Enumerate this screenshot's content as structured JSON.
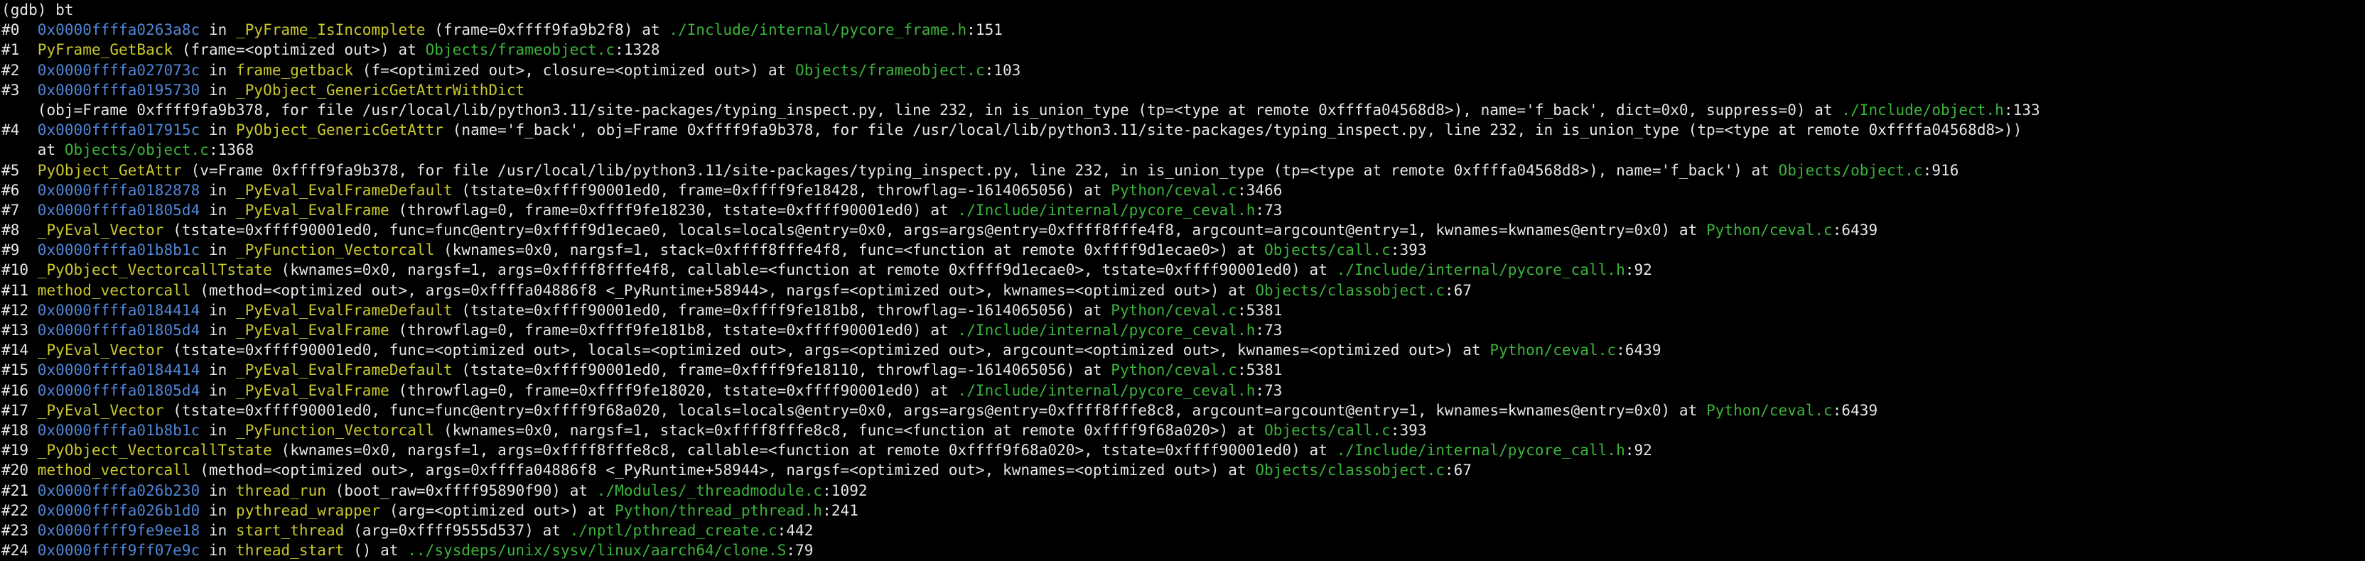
{
  "colors": {
    "background": "#000000",
    "text": "#e6e6e6",
    "address": "#4f86d8",
    "function": "#c9c92b",
    "file": "#3ab53a"
  },
  "lines": [
    [
      [
        "p",
        "(gdb) bt"
      ]
    ],
    [
      [
        "p",
        "#0  "
      ],
      [
        "a",
        "0x0000ffffa0263a8c"
      ],
      [
        "p",
        " in "
      ],
      [
        "f",
        "_PyFrame_IsIncomplete"
      ],
      [
        "p",
        " (frame=0xffff9fa9b2f8) at "
      ],
      [
        "s",
        "./Include/internal/pycore_frame.h"
      ],
      [
        "p",
        ":151"
      ]
    ],
    [
      [
        "p",
        "#1  "
      ],
      [
        "f",
        "PyFrame_GetBack"
      ],
      [
        "p",
        " (frame=<optimized out>) at "
      ],
      [
        "s",
        "Objects/frameobject.c"
      ],
      [
        "p",
        ":1328"
      ]
    ],
    [
      [
        "p",
        "#2  "
      ],
      [
        "a",
        "0x0000ffffa027073c"
      ],
      [
        "p",
        " in "
      ],
      [
        "f",
        "frame_getback"
      ],
      [
        "p",
        " (f=<optimized out>, closure=<optimized out>) at "
      ],
      [
        "s",
        "Objects/frameobject.c"
      ],
      [
        "p",
        ":103"
      ]
    ],
    [
      [
        "p",
        "#3  "
      ],
      [
        "a",
        "0x0000ffffa0195730"
      ],
      [
        "p",
        " in "
      ],
      [
        "f",
        "_PyObject_GenericGetAttrWithDict"
      ]
    ],
    [
      [
        "p",
        "    (obj=Frame 0xffff9fa9b378, for file /usr/local/lib/python3.11/site-packages/typing_inspect.py, line 232, in is_union_type (tp=<type at remote 0xffffa04568d8>), name='f_back', dict=0x0, suppress=0) at "
      ],
      [
        "s",
        "./Include/object.h"
      ],
      [
        "p",
        ":133"
      ]
    ],
    [
      [
        "p",
        "#4  "
      ],
      [
        "a",
        "0x0000ffffa017915c"
      ],
      [
        "p",
        " in "
      ],
      [
        "f",
        "PyObject_GenericGetAttr"
      ],
      [
        "p",
        " (name='f_back', obj=Frame 0xffff9fa9b378, for file /usr/local/lib/python3.11/site-packages/typing_inspect.py, line 232, in is_union_type (tp=<type at remote 0xffffa04568d8>))"
      ]
    ],
    [
      [
        "p",
        "    at "
      ],
      [
        "s",
        "Objects/object.c"
      ],
      [
        "p",
        ":1368"
      ]
    ],
    [
      [
        "p",
        "#5  "
      ],
      [
        "f",
        "PyObject_GetAttr"
      ],
      [
        "p",
        " (v=Frame 0xffff9fa9b378, for file /usr/local/lib/python3.11/site-packages/typing_inspect.py, line 232, in is_union_type (tp=<type at remote 0xffffa04568d8>), name='f_back') at "
      ],
      [
        "s",
        "Objects/object.c"
      ],
      [
        "p",
        ":916"
      ]
    ],
    [
      [
        "p",
        "#6  "
      ],
      [
        "a",
        "0x0000ffffa0182878"
      ],
      [
        "p",
        " in "
      ],
      [
        "f",
        "_PyEval_EvalFrameDefault"
      ],
      [
        "p",
        " (tstate=0xffff90001ed0, frame=0xffff9fe18428, throwflag=-1614065056) at "
      ],
      [
        "s",
        "Python/ceval.c"
      ],
      [
        "p",
        ":3466"
      ]
    ],
    [
      [
        "p",
        "#7  "
      ],
      [
        "a",
        "0x0000ffffa01805d4"
      ],
      [
        "p",
        " in "
      ],
      [
        "f",
        "_PyEval_EvalFrame"
      ],
      [
        "p",
        " (throwflag=0, frame=0xffff9fe18230, tstate=0xffff90001ed0) at "
      ],
      [
        "s",
        "./Include/internal/pycore_ceval.h"
      ],
      [
        "p",
        ":73"
      ]
    ],
    [
      [
        "p",
        "#8  "
      ],
      [
        "f",
        "_PyEval_Vector"
      ],
      [
        "p",
        " (tstate=0xffff90001ed0, func=func@entry=0xffff9d1ecae0, locals=locals@entry=0x0, args=args@entry=0xffff8fffe4f8, argcount=argcount@entry=1, kwnames=kwnames@entry=0x0) at "
      ],
      [
        "s",
        "Python/ceval.c"
      ],
      [
        "p",
        ":6439"
      ]
    ],
    [
      [
        "p",
        "#9  "
      ],
      [
        "a",
        "0x0000ffffa01b8b1c"
      ],
      [
        "p",
        " in "
      ],
      [
        "f",
        "_PyFunction_Vectorcall"
      ],
      [
        "p",
        " (kwnames=0x0, nargsf=1, stack=0xffff8fffe4f8, func=<function at remote 0xffff9d1ecae0>) at "
      ],
      [
        "s",
        "Objects/call.c"
      ],
      [
        "p",
        ":393"
      ]
    ],
    [
      [
        "p",
        "#10 "
      ],
      [
        "f",
        "_PyObject_VectorcallTstate"
      ],
      [
        "p",
        " (kwnames=0x0, nargsf=1, args=0xffff8fffe4f8, callable=<function at remote 0xffff9d1ecae0>, tstate=0xffff90001ed0) at "
      ],
      [
        "s",
        "./Include/internal/pycore_call.h"
      ],
      [
        "p",
        ":92"
      ]
    ],
    [
      [
        "p",
        "#11 "
      ],
      [
        "f",
        "method_vectorcall"
      ],
      [
        "p",
        " (method=<optimized out>, args=0xffffa04886f8 <_PyRuntime+58944>, nargsf=<optimized out>, kwnames=<optimized out>) at "
      ],
      [
        "s",
        "Objects/classobject.c"
      ],
      [
        "p",
        ":67"
      ]
    ],
    [
      [
        "p",
        "#12 "
      ],
      [
        "a",
        "0x0000ffffa0184414"
      ],
      [
        "p",
        " in "
      ],
      [
        "f",
        "_PyEval_EvalFrameDefault"
      ],
      [
        "p",
        " (tstate=0xffff90001ed0, frame=0xffff9fe181b8, throwflag=-1614065056) at "
      ],
      [
        "s",
        "Python/ceval.c"
      ],
      [
        "p",
        ":5381"
      ]
    ],
    [
      [
        "p",
        "#13 "
      ],
      [
        "a",
        "0x0000ffffa01805d4"
      ],
      [
        "p",
        " in "
      ],
      [
        "f",
        "_PyEval_EvalFrame"
      ],
      [
        "p",
        " (throwflag=0, frame=0xffff9fe181b8, tstate=0xffff90001ed0) at "
      ],
      [
        "s",
        "./Include/internal/pycore_ceval.h"
      ],
      [
        "p",
        ":73"
      ]
    ],
    [
      [
        "p",
        "#14 "
      ],
      [
        "f",
        "_PyEval_Vector"
      ],
      [
        "p",
        " (tstate=0xffff90001ed0, func=<optimized out>, locals=<optimized out>, args=<optimized out>, argcount=<optimized out>, kwnames=<optimized out>) at "
      ],
      [
        "s",
        "Python/ceval.c"
      ],
      [
        "p",
        ":6439"
      ]
    ],
    [
      [
        "p",
        "#15 "
      ],
      [
        "a",
        "0x0000ffffa0184414"
      ],
      [
        "p",
        " in "
      ],
      [
        "f",
        "_PyEval_EvalFrameDefault"
      ],
      [
        "p",
        " (tstate=0xffff90001ed0, frame=0xffff9fe18110, throwflag=-1614065056) at "
      ],
      [
        "s",
        "Python/ceval.c"
      ],
      [
        "p",
        ":5381"
      ]
    ],
    [
      [
        "p",
        "#16 "
      ],
      [
        "a",
        "0x0000ffffa01805d4"
      ],
      [
        "p",
        " in "
      ],
      [
        "f",
        "_PyEval_EvalFrame"
      ],
      [
        "p",
        " (throwflag=0, frame=0xffff9fe18020, tstate=0xffff90001ed0) at "
      ],
      [
        "s",
        "./Include/internal/pycore_ceval.h"
      ],
      [
        "p",
        ":73"
      ]
    ],
    [
      [
        "p",
        "#17 "
      ],
      [
        "f",
        "_PyEval_Vector"
      ],
      [
        "p",
        " (tstate=0xffff90001ed0, func=func@entry=0xffff9f68a020, locals=locals@entry=0x0, args=args@entry=0xffff8fffe8c8, argcount=argcount@entry=1, kwnames=kwnames@entry=0x0) at "
      ],
      [
        "s",
        "Python/ceval.c"
      ],
      [
        "p",
        ":6439"
      ]
    ],
    [
      [
        "p",
        "#18 "
      ],
      [
        "a",
        "0x0000ffffa01b8b1c"
      ],
      [
        "p",
        " in "
      ],
      [
        "f",
        "_PyFunction_Vectorcall"
      ],
      [
        "p",
        " (kwnames=0x0, nargsf=1, stack=0xffff8fffe8c8, func=<function at remote 0xffff9f68a020>) at "
      ],
      [
        "s",
        "Objects/call.c"
      ],
      [
        "p",
        ":393"
      ]
    ],
    [
      [
        "p",
        "#19 "
      ],
      [
        "f",
        "_PyObject_VectorcallTstate"
      ],
      [
        "p",
        " (kwnames=0x0, nargsf=1, args=0xffff8fffe8c8, callable=<function at remote 0xffff9f68a020>, tstate=0xffff90001ed0) at "
      ],
      [
        "s",
        "./Include/internal/pycore_call.h"
      ],
      [
        "p",
        ":92"
      ]
    ],
    [
      [
        "p",
        "#20 "
      ],
      [
        "f",
        "method_vectorcall"
      ],
      [
        "p",
        " (method=<optimized out>, args=0xffffa04886f8 <_PyRuntime+58944>, nargsf=<optimized out>, kwnames=<optimized out>) at "
      ],
      [
        "s",
        "Objects/classobject.c"
      ],
      [
        "p",
        ":67"
      ]
    ],
    [
      [
        "p",
        "#21 "
      ],
      [
        "a",
        "0x0000ffffa026b230"
      ],
      [
        "p",
        " in "
      ],
      [
        "f",
        "thread_run"
      ],
      [
        "p",
        " (boot_raw=0xffff95890f90) at "
      ],
      [
        "s",
        "./Modules/_threadmodule.c"
      ],
      [
        "p",
        ":1092"
      ]
    ],
    [
      [
        "p",
        "#22 "
      ],
      [
        "a",
        "0x0000ffffa026b1d0"
      ],
      [
        "p",
        " in "
      ],
      [
        "f",
        "pythread_wrapper"
      ],
      [
        "p",
        " (arg=<optimized out>) at "
      ],
      [
        "s",
        "Python/thread_pthread.h"
      ],
      [
        "p",
        ":241"
      ]
    ],
    [
      [
        "p",
        "#23 "
      ],
      [
        "a",
        "0x0000ffff9fe9ee18"
      ],
      [
        "p",
        " in "
      ],
      [
        "f",
        "start_thread"
      ],
      [
        "p",
        " (arg=0xffff9555d537) at "
      ],
      [
        "s",
        "./nptl/pthread_create.c"
      ],
      [
        "p",
        ":442"
      ]
    ],
    [
      [
        "p",
        "#24 "
      ],
      [
        "a",
        "0x0000ffff9ff07e9c"
      ],
      [
        "p",
        " in "
      ],
      [
        "f",
        "thread_start"
      ],
      [
        "p",
        " () at "
      ],
      [
        "s",
        "../sysdeps/unix/sysv/linux/aarch64/clone.S"
      ],
      [
        "p",
        ":79"
      ]
    ]
  ]
}
